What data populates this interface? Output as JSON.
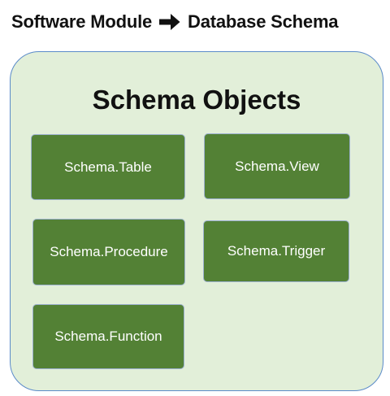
{
  "header": {
    "left_text": "Software Module",
    "arrow_icon": "right-arrow-icon",
    "right_text": "Database Schema"
  },
  "container": {
    "title": "Schema Objects",
    "background_color": "#e2efd9",
    "border_color": "#5b8bc9"
  },
  "objects": [
    {
      "label": "Schema.Table"
    },
    {
      "label": "Schema.View"
    },
    {
      "label": "Schema.Procedure"
    },
    {
      "label": "Schema.Trigger"
    },
    {
      "label": "Schema.Function"
    }
  ],
  "colors": {
    "box_fill": "#538135",
    "box_text": "#ffffff"
  }
}
